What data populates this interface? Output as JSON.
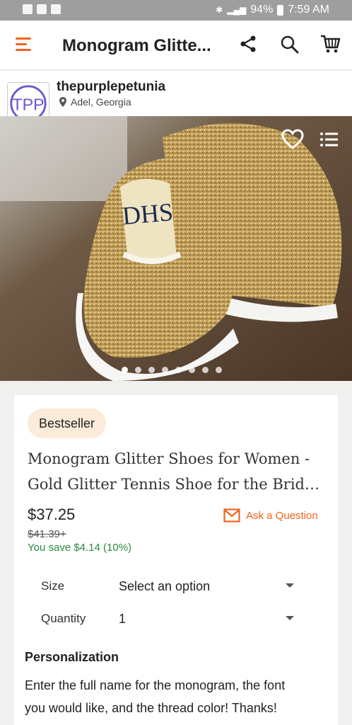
{
  "status_bar": {
    "battery": "94%",
    "time": "7:59 AM"
  },
  "app_bar": {
    "title": "Monogram Glitte..."
  },
  "shop": {
    "name": "thepurplepetunia",
    "location": "Adel, Georgia",
    "logo_text": "TPP"
  },
  "gallery": {
    "monogram_text": "DHS",
    "dot_count": 8,
    "active_dot": 0
  },
  "listing": {
    "badge": "Bestseller",
    "title_line_1": "Monogram Glitter Shoes for Women -",
    "title_line_2": "Gold Glitter Tennis Shoe for the Bride or...",
    "price": "$37.25",
    "original_price": "$41.39+",
    "savings": "You save $4.14 (10%)",
    "ask_question": "Ask a Question"
  },
  "options": {
    "size_label": "Size",
    "size_value": "Select an option",
    "quantity_label": "Quantity",
    "quantity_value": "1"
  },
  "personalization": {
    "heading": "Personalization",
    "body": "Enter the full name for the monogram, the font you would like, and the thread color! Thanks!"
  },
  "colors": {
    "accent": "#f1641e",
    "savings_green": "#2b8a3e",
    "badge_bg": "#fcebd8"
  }
}
